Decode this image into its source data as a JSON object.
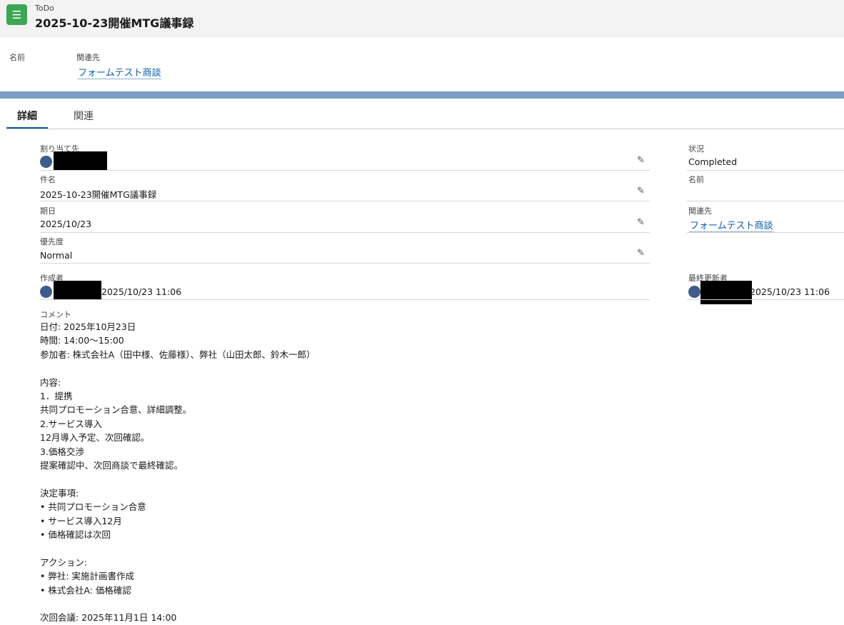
{
  "header": {
    "type": "ToDo",
    "title": "2025-10-23開催MTG議事録",
    "icon": "task-list-icon"
  },
  "highlights": {
    "name_label": "名前",
    "related_label": "関連先",
    "related_value": "フォームテスト商談"
  },
  "tabs": [
    {
      "label": "詳細",
      "selected": true
    },
    {
      "label": "関連",
      "selected": false
    }
  ],
  "left_fields": {
    "assigned_label": "割り当て先",
    "subject_label": "件名",
    "subject_value": "2025-10-23開催MTG議事録",
    "due_label": "期日",
    "due_value": "2025/10/23",
    "priority_label": "優先度",
    "priority_value": "Normal",
    "created_label": "作成者",
    "created_value": "2025/10/23 11:06"
  },
  "right_fields": {
    "status_label": "状況",
    "status_value": "Completed",
    "name_label": "名前",
    "related_label": "関連先",
    "related_value": "フォームテスト商談",
    "modified_label": "最終更新者",
    "modified_value": "2025/10/23 11:06"
  },
  "comment": {
    "label": "コメント",
    "lines": [
      "日付: 2025年10月23日",
      "時間: 14:00〜15:00",
      "参加者: 株式会社A（田中様、佐藤様）、弊社（山田太郎、鈴木一郎）",
      "",
      "内容:",
      "1．提携",
      "共同プロモーション合意、詳細調整。",
      "2.サービス導入",
      "12月導入予定、次回確認。",
      "3.価格交渉",
      "提案確認中、次回商談で最終確認。",
      "",
      "決定事項:",
      "• 共同プロモーション合意",
      "• サービス導入12月",
      "• 価格確認は次回",
      "",
      "アクション:",
      "• 弊社: 実施計画書作成",
      "• 株式会社A: 価格確認",
      "",
      "次回会議: 2025年11月1日 14:00"
    ]
  }
}
